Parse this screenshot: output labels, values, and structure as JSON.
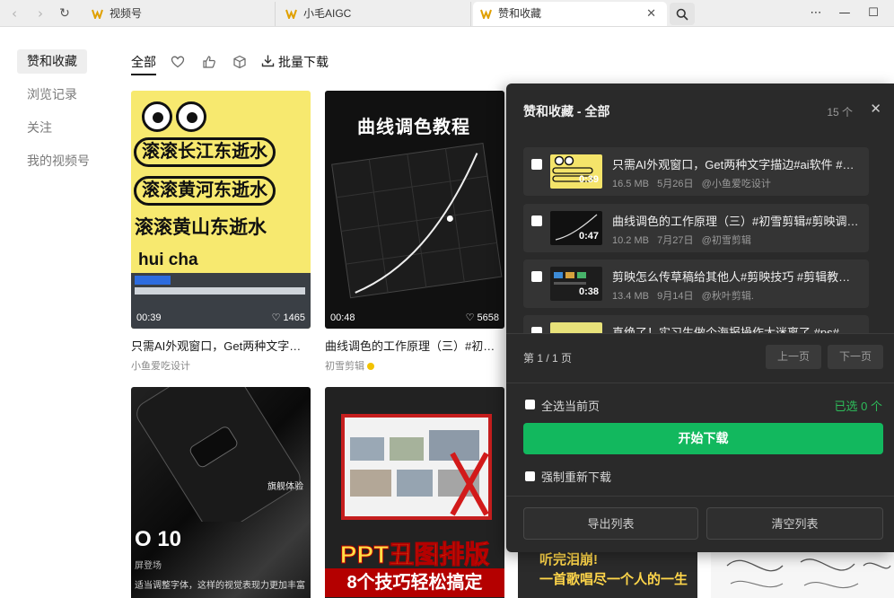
{
  "browser": {
    "tabs": [
      {
        "label": "视频号"
      },
      {
        "label": "小毛AIGC"
      },
      {
        "label": "赞和收藏"
      }
    ]
  },
  "sidebar": {
    "items": [
      {
        "label": "赞和收藏"
      },
      {
        "label": "浏览记录"
      },
      {
        "label": "关注"
      },
      {
        "label": "我的视频号"
      }
    ]
  },
  "filter": {
    "all_label": "全部",
    "batch_download_label": "批量下载"
  },
  "grid": {
    "cards": [
      {
        "title": "只需AI外观窗口，Get两种文字描边#ai软件 #ai...",
        "author": "小鱼爱吃设计",
        "duration": "00:39",
        "likes": "1465",
        "thumb_text": [
          "滚滚长江东逝水",
          "滚滚黄河东逝水",
          "滚滚黄山东逝水",
          "hui cha"
        ]
      },
      {
        "title": "曲线调色的工作原理（三）#初雪剪辑",
        "author": "初雪剪辑",
        "duration": "00:48",
        "likes": "5658",
        "thumb_text": [
          "曲线调色教程"
        ]
      },
      {
        "thumb_text": [
          "旗舰体验",
          "O 10",
          "屏登场",
          "适当调整字体，这样的视觉表现力更加丰富"
        ]
      },
      {
        "thumb_text": [
          "PPT丑图排版",
          "8个技巧轻松搞定"
        ]
      },
      {
        "thumb_text": [
          "听完泪崩!",
          "一首歌唱尽一个人的一生"
        ]
      }
    ]
  },
  "panel": {
    "title": "赞和收藏 - 全部",
    "count": "15 个",
    "items": [
      {
        "title": "只需AI外观窗口，Get两种文字描边#ai软件 #ai...",
        "size": "16.5 MB",
        "date": "5月26日",
        "author": "@小鱼爱吃设计",
        "duration": "0:39"
      },
      {
        "title": "曲线调色的工作原理（三）#初雪剪辑#剪映调色...",
        "size": "10.2 MB",
        "date": "7月27日",
        "author": "@初雪剪辑",
        "duration": "0:47"
      },
      {
        "title": "剪映怎么传草稿给其他人#剪映技巧 #剪辑教程 ...",
        "size": "13.4 MB",
        "date": "9月14日",
        "author": "@秋叶剪辑.",
        "duration": "0:38"
      },
      {
        "title": "真绝了！实习生做个海报操作太迷离了 #ps#大..."
      }
    ],
    "page_info": "第 1 / 1 页",
    "prev_label": "上一页",
    "next_label": "下一页",
    "select_all_label": "全选当前页",
    "selected_label": "已选 0 个",
    "start_label": "开始下载",
    "force_label": "强制重新下载",
    "export_label": "导出列表",
    "clear_label": "清空列表"
  }
}
